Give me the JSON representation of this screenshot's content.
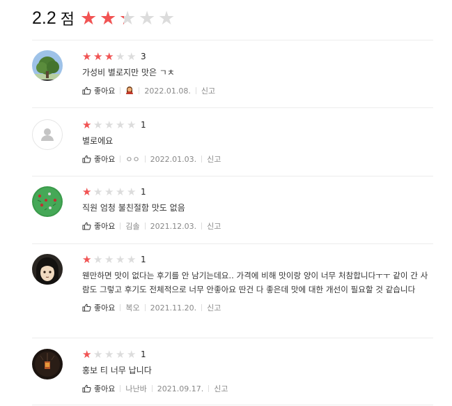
{
  "summary": {
    "score": "2.2",
    "unit": "점",
    "rating": 2.2
  },
  "reviews": [
    {
      "rating": 3,
      "rating_text": "3",
      "text": "가성비 별로지만 맛은 ㄱㅊ",
      "like": "좋아요",
      "author": "",
      "author_icon": "person-emoji-icon",
      "date": "2022.01.08.",
      "report": "신고"
    },
    {
      "rating": 1,
      "rating_text": "1",
      "text": "별로에요",
      "like": "좋아요",
      "author": "ㅇㅇ",
      "date": "2022.01.03.",
      "report": "신고"
    },
    {
      "rating": 1,
      "rating_text": "1",
      "text": "직원 엄청 불친절함 맛도 없음",
      "like": "좋아요",
      "author": "김솔",
      "date": "2021.12.03.",
      "report": "신고"
    },
    {
      "rating": 1,
      "rating_text": "1",
      "text": "웬만하면 맛이 없다는 후기를 안 남기는데요.. 가격에 비해 맛이랑 양이 너무 처참합니다ㅜㅜ 같이 간 사람도 그렇고 후기도 전체적으로 너무 안좋아요  딴건 다 좋은데 맛에 대한 개선이 필요할 것 같습니다",
      "like": "좋아요",
      "author": "복오",
      "date": "2021.11.20.",
      "report": "신고"
    },
    {
      "rating": 1,
      "rating_text": "1",
      "text": "홍보 티 너무 납니다",
      "like": "좋아요",
      "author": "나난바",
      "date": "2021.09.17.",
      "report": "신고"
    }
  ],
  "colors": {
    "star_filled": "#f25353",
    "star_empty": "#dcdcdc"
  }
}
